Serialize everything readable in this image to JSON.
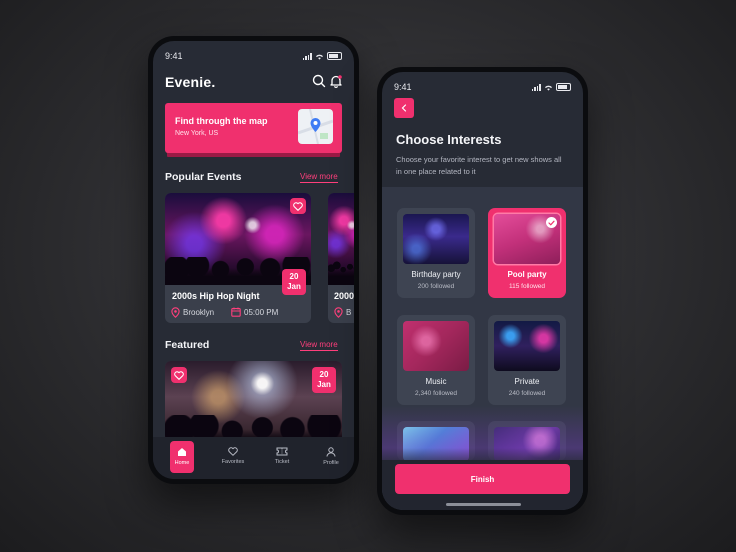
{
  "colors": {
    "accent": "#f0306e",
    "background": "#272b35",
    "card": "#3a3f4b"
  },
  "home": {
    "status_time": "9:41",
    "brand": "Evenie.",
    "icons": {
      "search": "search-icon",
      "notifications": "bell-icon"
    },
    "map_card": {
      "title": "Find through the map",
      "subtitle": "New York, US"
    },
    "popular": {
      "title": "Popular Events",
      "view_more": "View more",
      "events": [
        {
          "name": "2000s Hip Hop Night",
          "day": "20",
          "month": "Jan",
          "location": "Brooklyn",
          "time": "05:00 PM"
        },
        {
          "name": "2000",
          "location": "B"
        }
      ]
    },
    "featured": {
      "title": "Featured",
      "view_more": "View more",
      "event": {
        "day": "20",
        "month": "Jan"
      }
    },
    "tabs": [
      {
        "label": "Home",
        "icon": "home-icon"
      },
      {
        "label": "Favorites",
        "icon": "heart-icon"
      },
      {
        "label": "Ticket",
        "icon": "ticket-icon"
      },
      {
        "label": "Profile",
        "icon": "user-icon"
      }
    ]
  },
  "interests": {
    "status_time": "9:41",
    "heading": "Choose Interests",
    "description": "Choose your favorite interest to get new shows all in one place related to it",
    "items": [
      {
        "label": "Birthday party",
        "followed": "200 followed",
        "selected": false
      },
      {
        "label": "Pool party",
        "followed": "115 followed",
        "selected": true
      },
      {
        "label": "Music",
        "followed": "2,340 followed",
        "selected": false
      },
      {
        "label": "Private",
        "followed": "240 followed",
        "selected": false
      }
    ],
    "finish_label": "Finish"
  }
}
